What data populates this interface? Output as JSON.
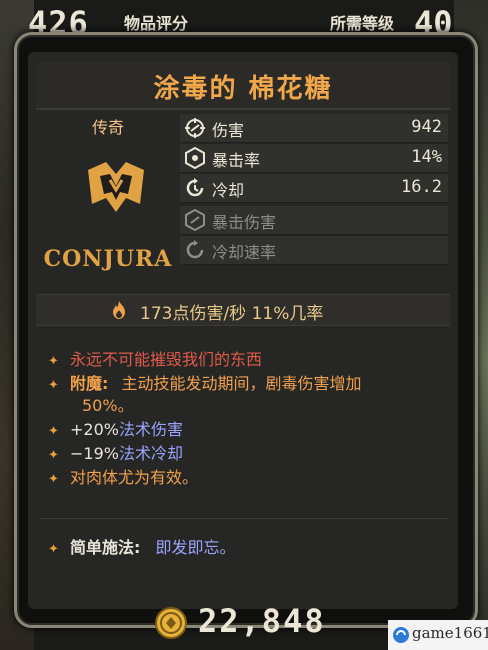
{
  "header": {
    "item_score": "426",
    "item_score_label": "物品评分",
    "required_level_label": "所需等级",
    "required_level": "40"
  },
  "item": {
    "name": "涂毒的 棉花糖",
    "rarity": "传奇",
    "brand": "CONJURA"
  },
  "stats": [
    {
      "icon": "damage-icon",
      "name": "伤害",
      "value": "942",
      "active": true
    },
    {
      "icon": "crit-rate-icon",
      "name": "暴击率",
      "value": "14%",
      "active": true
    },
    {
      "icon": "cooldown-icon",
      "name": "冷却",
      "value": "16.2",
      "active": true
    },
    {
      "icon": "crit-damage-icon",
      "name": "暴击伤害",
      "value": "",
      "active": false
    },
    {
      "icon": "cooldown-rate-icon",
      "name": "冷却速率",
      "value": "",
      "active": false
    }
  ],
  "dps": {
    "icon": "fire-icon",
    "text": "173点伤害/秒  11%几率"
  },
  "description": {
    "flavor": "永远不可能摧毁我们的东西",
    "anoint_label": "附魔:",
    "anoint_text_1": "主动技能发动期间，剧毒伤害增加",
    "anoint_text_2": "50%。",
    "bonus_1_value": "+20%",
    "bonus_1_text": "法术伤害",
    "bonus_2_value": "−19%",
    "bonus_2_text": "法术冷却",
    "effective": "对肉体尤为有效。"
  },
  "cast": {
    "label": "简单施法:",
    "value": "即发即忘。"
  },
  "price": {
    "icon": "coin-icon",
    "value": "22,848"
  },
  "watermark": {
    "text": "game1661"
  },
  "colors": {
    "title": "#f0a74a",
    "rarity": "#f2c28a",
    "flavor": "#e05a4a",
    "anoint": "#f0a14c",
    "spell": "#9aa4ff"
  }
}
